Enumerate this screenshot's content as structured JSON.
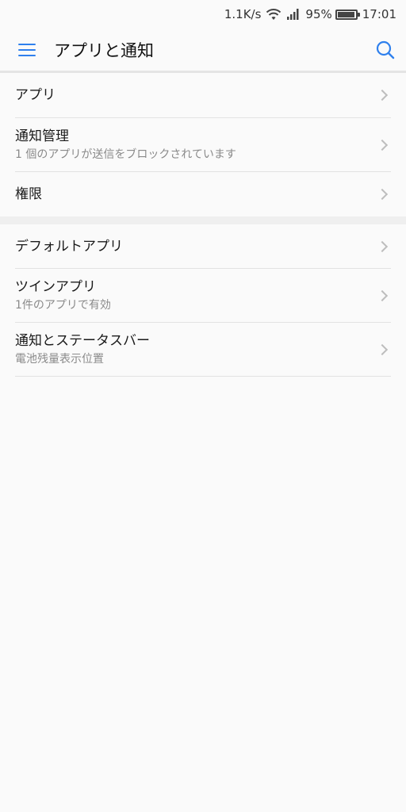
{
  "status": {
    "net_speed": "1.1K/s",
    "battery_pct": "95%",
    "battery_level": 0.95,
    "time": "17:01",
    "icons": [
      "wifi-icon",
      "signal-icon",
      "battery-icon"
    ]
  },
  "header": {
    "title": "アプリと通知",
    "accent": "#2f80ed",
    "icons": [
      "menu-icon",
      "search-icon"
    ]
  },
  "group1": {
    "items": [
      {
        "title": "アプリ",
        "sub": ""
      },
      {
        "title": "通知管理",
        "sub": "1 個のアプリが送信をブロックされています"
      },
      {
        "title": "権限",
        "sub": ""
      }
    ]
  },
  "group2": {
    "items": [
      {
        "title": "デフォルトアプリ",
        "sub": ""
      },
      {
        "title": "ツインアプリ",
        "sub": "1件のアプリで有効"
      },
      {
        "title": "通知とステータスバー",
        "sub": "電池残量表示位置"
      }
    ]
  },
  "chevron_icon": "chevron-right-icon"
}
